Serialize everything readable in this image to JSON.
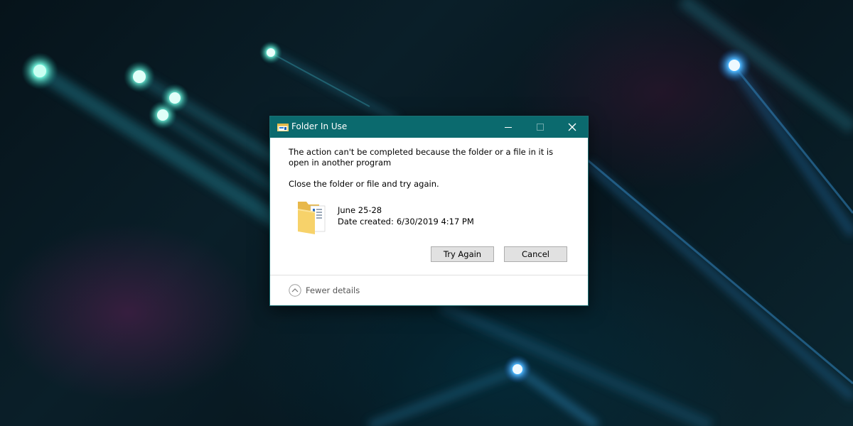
{
  "dialog": {
    "title": "Folder In Use",
    "message": "The action can't be completed because the folder or a file in it is open in another program",
    "instruction": "Close the folder or file and try again.",
    "item": {
      "name": "June 25-28",
      "date_label": "Date created:",
      "date_value": "6/30/2019 4:17 PM",
      "icon": "folder-icon"
    },
    "buttons": {
      "try_again": "Try Again",
      "cancel": "Cancel"
    },
    "details_toggle": "Fewer details",
    "title_icon": "explorer-icon",
    "window_controls": [
      "minimize-icon",
      "maximize-icon",
      "close-icon"
    ]
  },
  "colors": {
    "titlebar": "#0b6a6e",
    "dialog_bg": "#ffffff",
    "button_bg": "#e1e1e1",
    "wallpaper_dark": "#07161e"
  }
}
